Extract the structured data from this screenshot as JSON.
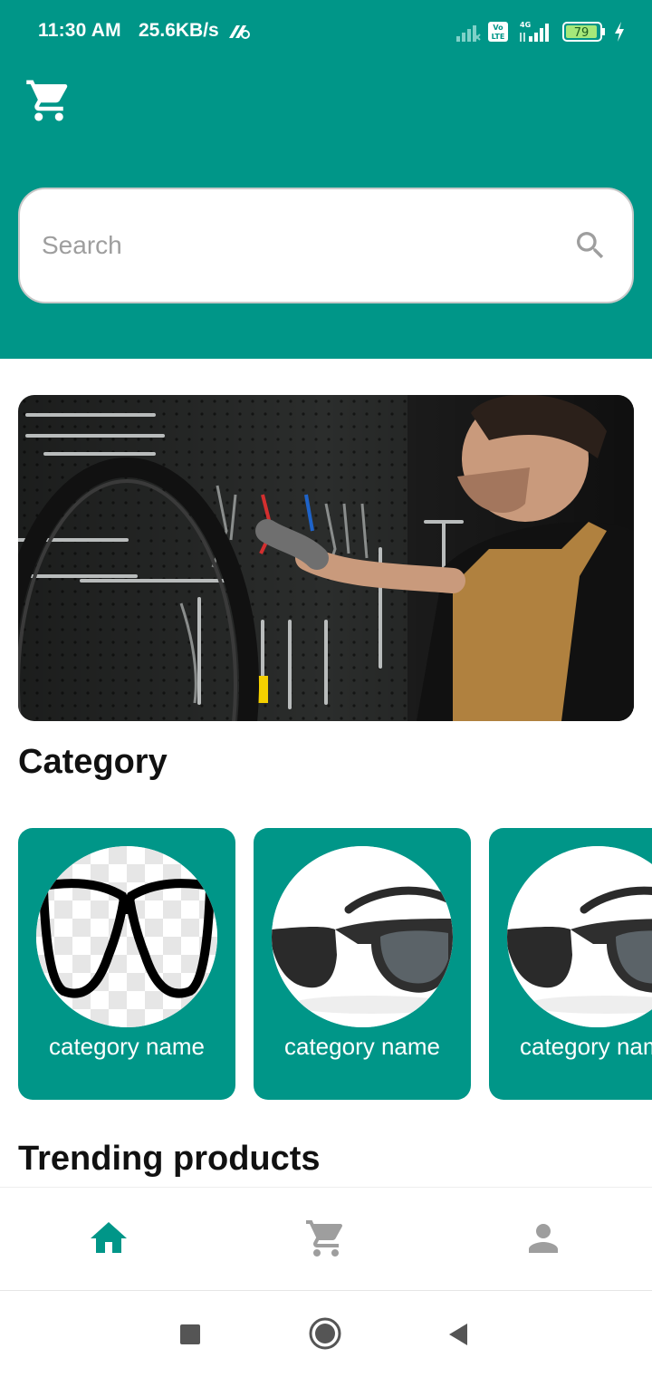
{
  "status_bar": {
    "time": "11:30 AM",
    "speed": "25.6KB/s",
    "battery": "79",
    "network": "4G",
    "volte": "Vo LTE"
  },
  "header": {
    "cart_icon": "cart-icon",
    "background_color": "#009688"
  },
  "search": {
    "placeholder": "Search",
    "icon": "search-icon"
  },
  "banner": {
    "image": "bicycle-workshop-tools-photo"
  },
  "category": {
    "title": "Category",
    "items": [
      {
        "label": "category name",
        "image": "eyeglasses-frame"
      },
      {
        "label": "category name",
        "image": "sunglasses"
      },
      {
        "label": "category name",
        "image": "sunglasses"
      }
    ]
  },
  "trending": {
    "title": "Trending products"
  },
  "bottom_nav": {
    "items": [
      {
        "icon": "home-icon",
        "active": true
      },
      {
        "icon": "cart-icon",
        "active": false
      },
      {
        "icon": "person-icon",
        "active": false
      }
    ],
    "active_color": "#009688",
    "inactive_color": "#9e9e9e"
  },
  "system_nav": {
    "items": [
      "recents-button",
      "home-button",
      "back-button"
    ]
  }
}
